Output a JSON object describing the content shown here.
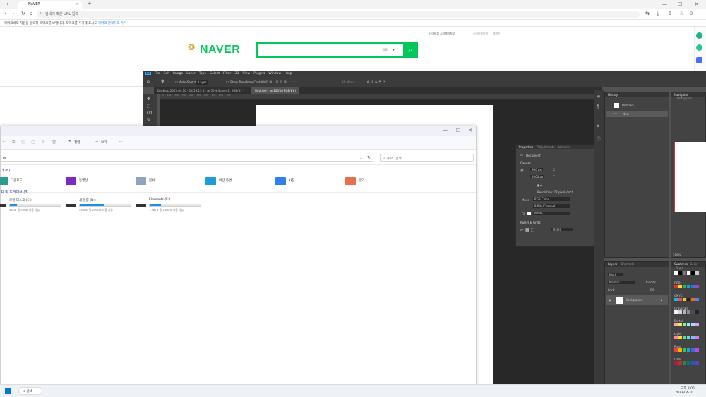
{
  "browser": {
    "tab_title": "NAVER",
    "new_tab": "+",
    "window_min": "—",
    "window_max": "☐",
    "window_close": "✕",
    "address_placeholder": "검색어 혹은 URL 입력",
    "infobar_text": "북마크바로 지원을 클릭해 북마크를 보냅니다. 북마크를 추가해 표시도",
    "infobar_link": "북마크 관리자로 가기"
  },
  "naver": {
    "logo_text": "NAVER",
    "toplink_1": "네이버를 시작페이지로",
    "toplink_2": "쥬니어네이버",
    "toplink_3": "해피빈"
  },
  "photoshop": {
    "menu": [
      "Ps",
      "File",
      "Edit",
      "Image",
      "Layer",
      "Type",
      "Select",
      "Filter",
      "3D",
      "View",
      "Plugins",
      "Window",
      "Help"
    ],
    "options": {
      "auto_select": "Auto-Select:",
      "layer_dropdown": "Layer",
      "transform": "Show Transform Controls",
      "mode_3d": "3D Mode:"
    },
    "doc_tabs": [
      "Desktop 2023.04.10 - 14.59.13.01 @ 50% (Layer 1, RGB/8) *",
      "Untitled-1 @ 100% (RGB/8#)"
    ],
    "history": {
      "title": "History",
      "snapshot": "Untitled-1",
      "state": "New"
    },
    "navigator": {
      "tab_active": "Navigator",
      "tab_other": "Histogram",
      "zoom": "100%"
    },
    "properties": {
      "tabs": [
        "Properties",
        "Adjustments",
        "Libraries"
      ],
      "type": "Document",
      "canvas_header": "Canvas",
      "w_value": "960 px",
      "h_value": "1000 px",
      "x_label": "X",
      "y_label": "Y",
      "resolution": "Resolution: 72 pixels/inch",
      "mode_label": "Mode",
      "mode_value": "RGB Color",
      "depth_value": "8 Bits/Channel",
      "fill_label": "Fill",
      "fill_value": "White",
      "rulers_header": "Rulers & Grids",
      "units_value": "Pixels"
    },
    "layers": {
      "tab_active": "Layers",
      "tab_other": "Channels",
      "kind": "Kind",
      "blend": "Normal",
      "opacity_label": "Opacity:",
      "lock_label": "Lock:",
      "fill_label": "Fill:",
      "layer_name": "Background"
    },
    "swatches": {
      "tabs": [
        "Swatches",
        "Color",
        "Gradi"
      ],
      "groups": [
        "RGB",
        "CMYK",
        "Grayscale",
        "Pastel",
        "Light",
        "Pure",
        "Dark"
      ]
    }
  },
  "explorer": {
    "toolbar": {
      "sort": "정렬",
      "view": "보기",
      "more": "···"
    },
    "address": "PC",
    "search_placeholder": "내 PC 검색",
    "section_folders": "더 (6)",
    "folders": [
      "다운로드",
      "동영상",
      "문서",
      "바탕 화면",
      "사진",
      "음악"
    ],
    "section_drives": "치 및 드라이브 (3)",
    "drives": [
      {
        "name": "로컬 디스크 (C:)",
        "space": "58GB 중 50GB 사용 가능",
        "used": 0.14
      },
      {
        "name": "새 볼륨 (D:)",
        "space": "545GB 중 290GB 사용 가능",
        "used": 0.47
      },
      {
        "name": "Elements (E:)",
        "space": "1.36TB 중 1.06TB 사용 가능",
        "used": 0.22
      }
    ]
  },
  "taskbar": {
    "search_label": "검색",
    "time": "오후 3:06",
    "date": "2023-04-10"
  }
}
